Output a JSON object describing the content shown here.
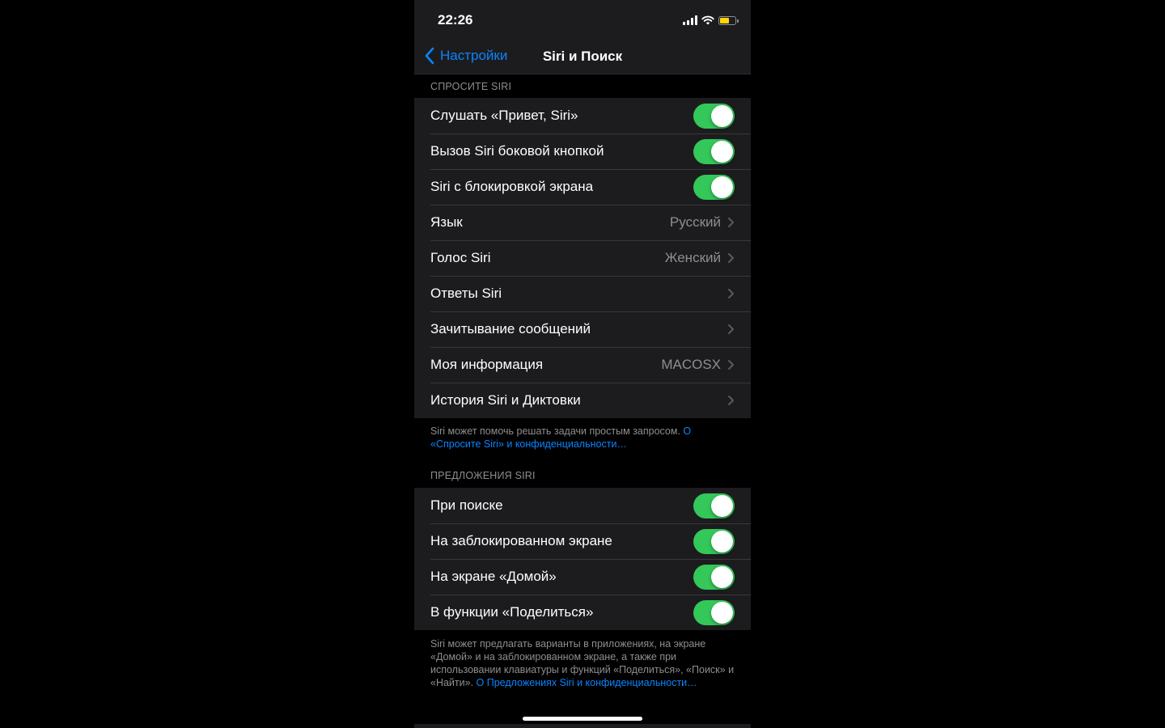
{
  "status": {
    "time": "22:26"
  },
  "nav": {
    "back_label": "Настройки",
    "title": "Siri и Поиск"
  },
  "ask_siri": {
    "header": "СПРОСИТЕ SIRI",
    "rows": [
      {
        "label": "Слушать «Привет, Siri»",
        "type": "toggle",
        "on": true
      },
      {
        "label": "Вызов Siri боковой кнопкой",
        "type": "toggle",
        "on": true
      },
      {
        "label": "Siri с блокировкой экрана",
        "type": "toggle",
        "on": true
      },
      {
        "label": "Язык",
        "type": "nav",
        "value": "Русский"
      },
      {
        "label": "Голос Siri",
        "type": "nav",
        "value": "Женский"
      },
      {
        "label": "Ответы Siri",
        "type": "nav",
        "value": ""
      },
      {
        "label": "Зачитывание сообщений",
        "type": "nav",
        "value": ""
      },
      {
        "label": "Моя информация",
        "type": "nav",
        "value": "MACOSX"
      },
      {
        "label": "История Siri и Диктовки",
        "type": "nav",
        "value": ""
      }
    ],
    "footer_text": "Siri может помочь решать задачи простым запросом. ",
    "footer_link": "О «Спросите Siri» и конфиденциальности…"
  },
  "suggestions": {
    "header": "ПРЕДЛОЖЕНИЯ SIRI",
    "rows": [
      {
        "label": "При поиске",
        "type": "toggle",
        "on": true
      },
      {
        "label": "На заблокированном экране",
        "type": "toggle",
        "on": true
      },
      {
        "label": "На экране «Домой»",
        "type": "toggle",
        "on": true
      },
      {
        "label": "В функции «Поделиться»",
        "type": "toggle",
        "on": true
      }
    ],
    "footer_text": "Siri может предлагать варианты в приложениях, на экране «Домой» и на заблокированном экране, а также при использовании клавиатуры и функций «Поделиться», «Поиск» и «Найти». ",
    "footer_link": "О Предложениях Siri и конфиденциальности…"
  },
  "colors": {
    "accent": "#0a84ff",
    "toggle_on": "#34c759",
    "battery": "#ffd60a"
  },
  "icons": [
    "chevron-left-icon",
    "chevron-right-icon",
    "signal-icon",
    "wifi-icon",
    "battery-icon"
  ]
}
